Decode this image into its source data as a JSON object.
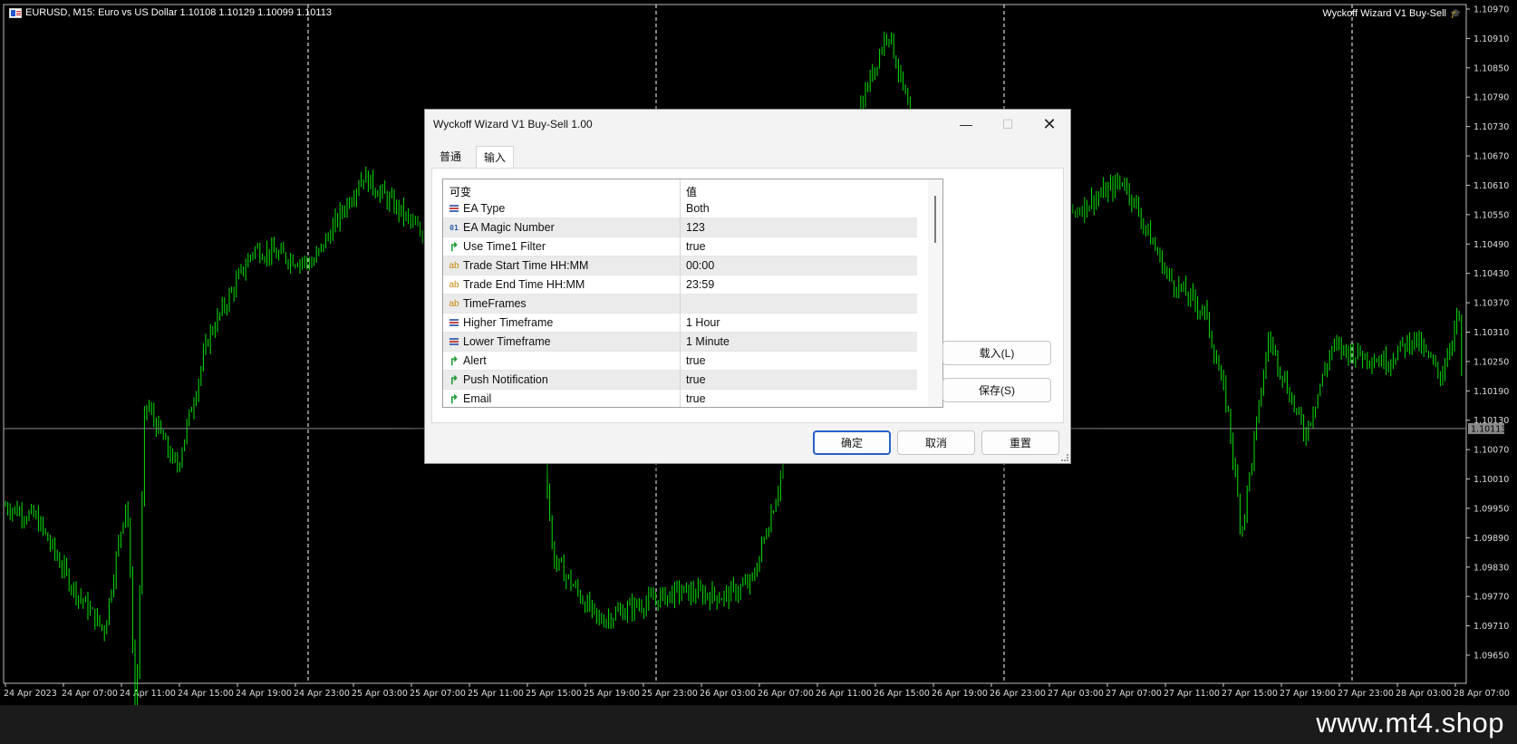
{
  "chart": {
    "title": "EURUSD, M15:  Euro vs US Dollar  1.10108 1.10129 1.10099 1.10113",
    "ea_label": "Wyckoff Wizard V1 Buy-Sell",
    "current_price": "1.10113",
    "price_labels": [
      "1.10970",
      "1.10910",
      "1.10850",
      "1.10790",
      "1.10730",
      "1.10670",
      "1.10610",
      "1.10550",
      "1.10490",
      "1.10430",
      "1.10370",
      "1.10310",
      "1.10250",
      "1.10190",
      "1.10130",
      "1.10070",
      "1.10010",
      "1.09950",
      "1.09890",
      "1.09830",
      "1.09770",
      "1.09710",
      "1.09650"
    ],
    "time_labels": [
      "24 Apr 2023",
      "24 Apr 07:00",
      "24 Apr 11:00",
      "24 Apr 15:00",
      "24 Apr 19:00",
      "24 Apr 23:00",
      "25 Apr 03:00",
      "25 Apr 07:00",
      "25 Apr 11:00",
      "25 Apr 15:00",
      "25 Apr 19:00",
      "25 Apr 23:00",
      "26 Apr 03:00",
      "26 Apr 07:00",
      "26 Apr 11:00",
      "26 Apr 15:00",
      "26 Apr 19:00",
      "26 Apr 23:00",
      "27 Apr 03:00",
      "27 Apr 07:00",
      "27 Apr 11:00",
      "27 Apr 15:00",
      "27 Apr 19:00",
      "27 Apr 23:00",
      "28 Apr 03:00",
      "28 Apr 07:00"
    ],
    "candle_color": "#00e600",
    "grid_color": "#ffffff"
  },
  "dialog": {
    "title": "Wyckoff Wizard V1 Buy-Sell 1.00",
    "tabs": [
      "普通",
      "输入"
    ],
    "columns": [
      "可变",
      "值"
    ],
    "rows": [
      {
        "icon": "enum-icon",
        "name": "EA Type",
        "value": "Both"
      },
      {
        "icon": "int-icon",
        "name": "EA Magic Number",
        "value": "123"
      },
      {
        "icon": "bool-icon",
        "name": "Use Time1 Filter",
        "value": "true"
      },
      {
        "icon": "string-icon",
        "name": "Trade Start Time HH:MM",
        "value": "00:00"
      },
      {
        "icon": "string-icon",
        "name": "Trade End Time HH:MM",
        "value": "23:59"
      },
      {
        "icon": "string-icon",
        "name": "TimeFrames",
        "value": ""
      },
      {
        "icon": "enum-icon",
        "name": "Higher Timeframe",
        "value": "1 Hour"
      },
      {
        "icon": "enum-icon",
        "name": "Lower Timeframe",
        "value": "1 Minute"
      },
      {
        "icon": "bool-icon",
        "name": "Alert",
        "value": "true"
      },
      {
        "icon": "bool-icon",
        "name": "Push Notification",
        "value": "true"
      },
      {
        "icon": "bool-icon",
        "name": "Email",
        "value": "true"
      }
    ],
    "icon_glyphs": {
      "int": "01",
      "string": "ab",
      "bool": "↱"
    },
    "buttons": {
      "load": "载入(L)",
      "save": "保存(S)",
      "ok": "确定",
      "cancel": "取消",
      "reset": "重置"
    },
    "window_controls": {
      "minimize": "—",
      "maximize": "☐",
      "close": "✕"
    }
  },
  "footer": {
    "text": "www.mt4.shop"
  }
}
